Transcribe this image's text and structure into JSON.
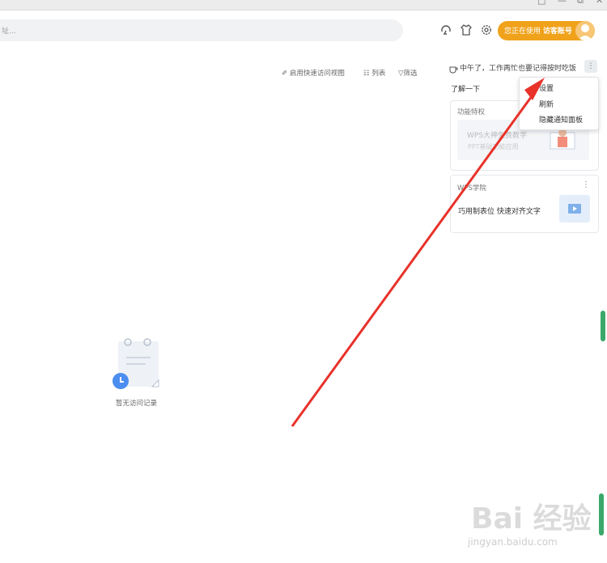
{
  "titlebar": {
    "buttons": [
      "□",
      "—",
      "⧉",
      "✕"
    ]
  },
  "search": {
    "placeholder": "址..."
  },
  "account": {
    "label_prefix": "您正在使用",
    "label_account": "访客账号"
  },
  "toolbar": {
    "quick_view": "启用快速访问视图",
    "list": "列表",
    "filter": "筛选"
  },
  "greeting": "中午了，工作再忙也要记得按时吃饭",
  "more_label": "⋮",
  "section_title": "了解一下",
  "cards": {
    "feature": {
      "header": "功能特权",
      "title": "WPS大神免费教学",
      "subtitle": "PPT基础功能应用"
    },
    "academy": {
      "header": "WPS学院",
      "title": "巧用制表位 快速对齐文字"
    }
  },
  "context_menu": {
    "items": [
      "设置",
      "刷新",
      "隐藏通知面板"
    ]
  },
  "empty_state": {
    "label": "暂无访问记录"
  },
  "watermark": {
    "brand": "Bai  经验",
    "url": "jingyan.baidu.com"
  },
  "colors": {
    "accent": "#f0a21a",
    "arrow": "#e8322a",
    "scroll": "#3aa86a"
  },
  "icons": [
    "headset-icon",
    "shirt-icon",
    "gear-icon",
    "user-avatar-icon",
    "coffee-icon",
    "clock-icon"
  ]
}
